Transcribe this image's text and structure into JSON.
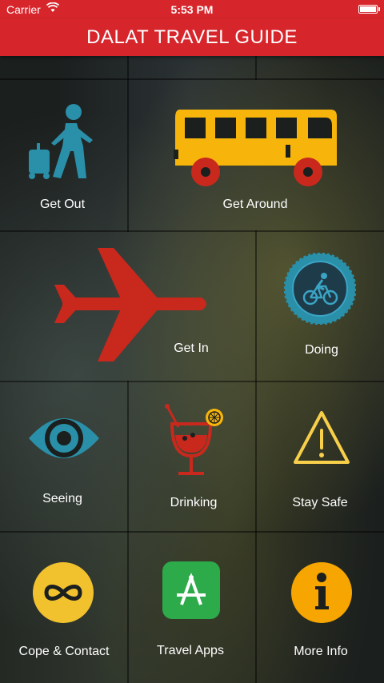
{
  "status_bar": {
    "carrier": "Carrier",
    "time": "5:53 PM",
    "battery_level": 1.0
  },
  "header": {
    "title": "DALAT TRAVEL GUIDE"
  },
  "tiles": {
    "get_out": {
      "label": "Get Out",
      "icon": "traveler-luggage-icon"
    },
    "get_around": {
      "label": "Get Around",
      "icon": "bus-icon"
    },
    "get_in": {
      "label": "Get In",
      "icon": "airplane-icon"
    },
    "doing": {
      "label": "Doing",
      "icon": "bicycle-badge-icon"
    },
    "seeing": {
      "label": "Seeing",
      "icon": "eye-icon"
    },
    "drinking": {
      "label": "Drinking",
      "icon": "cocktail-icon"
    },
    "stay_safe": {
      "label": "Stay Safe",
      "icon": "warning-icon"
    },
    "cope_contact": {
      "label": "Cope & Contact",
      "icon": "infinity-icon"
    },
    "travel_apps": {
      "label": "Travel Apps",
      "icon": "app-store-icon"
    },
    "more_info": {
      "label": "More Info",
      "icon": "info-icon"
    }
  },
  "colors": {
    "header": "#d6262c",
    "teal": "#2a8fa8",
    "yellow": "#f7b50c",
    "red": "#c9281d",
    "green": "#2daa4a",
    "orange": "#f7a500"
  }
}
